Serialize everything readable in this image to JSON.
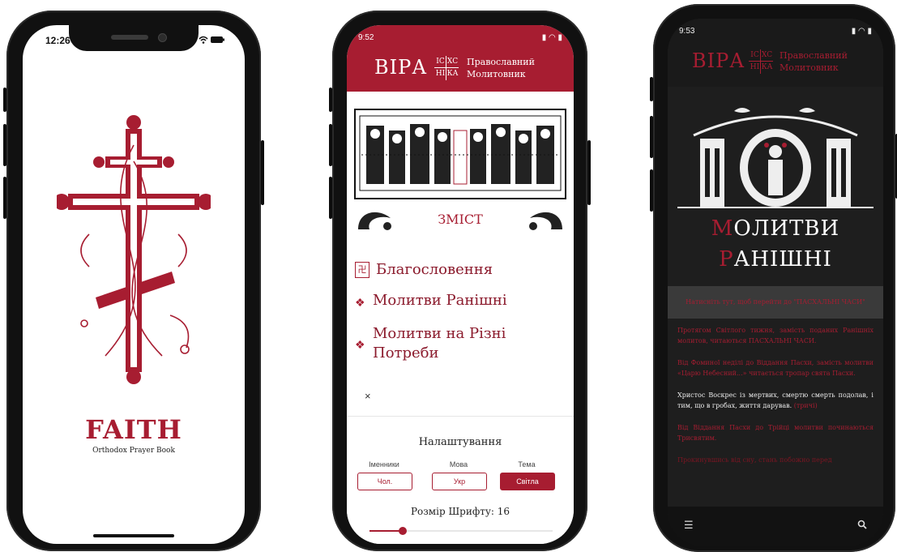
{
  "colors": {
    "accent": "#a71d31",
    "dark_bg": "#1e1e1e"
  },
  "phone1": {
    "status_time": "12:26",
    "title": "FAITH",
    "subtitle": "Orthodox Prayer Book"
  },
  "phone2": {
    "status_time": "9:52",
    "header": {
      "brand": "ВІРА",
      "icon_letters": [
        "ІС",
        "ХС",
        "НІ",
        "КА"
      ],
      "tagline_line1": "Православний",
      "tagline_line2": "Молитовник"
    },
    "contents_heading": "ЗМІСТ",
    "toc": [
      {
        "label": "Благословення"
      },
      {
        "label": "Молитви Ранішні"
      },
      {
        "label": "Молитви на Різні Потреби"
      }
    ],
    "close_label": "×",
    "settings": {
      "title": "Налаштування",
      "options": [
        {
          "label": "Іменники",
          "value": "Чол."
        },
        {
          "label": "Мова",
          "value": "Укр"
        },
        {
          "label": "Тема",
          "value": "Світла",
          "active": true
        }
      ],
      "font_size_label": "Розмір Шрифту: 16",
      "font_size_fraction": 0.18
    }
  },
  "phone3": {
    "status_time": "9:53",
    "header": {
      "brand": "ВІРА",
      "icon_letters": [
        "ІС",
        "ХС",
        "НІ",
        "КА"
      ],
      "tagline_line1": "Православний",
      "tagline_line2": "Молитовник"
    },
    "title_line1_first": "М",
    "title_line1_rest": "ОЛИТВИ",
    "title_line2_first": "Р",
    "title_line2_rest": "АНІШНІ",
    "strip_text": "Натисніть тут, щоб перейти до \"ПАСХАЛЬНІ ЧАСИ\"",
    "paragraphs": [
      {
        "text": "Протягом Світлого тижня, замість поданих Ранішніх молитов, читаються ПАСХАЛЬНІ ЧАСИ.",
        "style": "red"
      },
      {
        "text": "Від Фоминої неділі до Віддання Пасхи, замість молитви «Царю Небесний...» читається тропар свята Пасхи.",
        "style": "red"
      },
      {
        "text": "Христос Воскрес із мертвих, смертю смерть подолав, і тим, що в гробах, життя дарував.",
        "tail": "(тричі)",
        "style": "white"
      },
      {
        "text": "Від Віддання Пасхи до Трійці молитви починаються Трисвятим.",
        "style": "red"
      },
      {
        "text": "Прокинувшись від сну, стань побожно перед",
        "style": "dim"
      }
    ]
  }
}
